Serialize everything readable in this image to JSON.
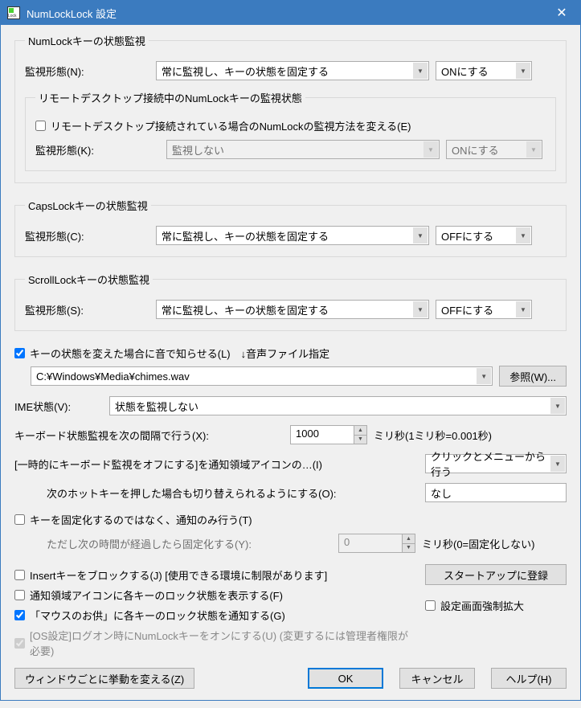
{
  "title": "NumLockLock 設定",
  "groups": {
    "numlock": {
      "legend": "NumLockキーの状態監視",
      "mode_label": "監視形態(N):",
      "mode_value": "常に監視し、キーの状態を固定する",
      "onoff": "ONにする",
      "remote": {
        "legend": "リモートデスクトップ接続中のNumLockキーの監視状態",
        "checkbox_label": "リモートデスクトップ接続されている場合のNumLockの監視方法を変える(E)",
        "mode_label": "監視形態(K):",
        "mode_value": "監視しない",
        "onoff": "ONにする"
      }
    },
    "capslock": {
      "legend": "CapsLockキーの状態監視",
      "mode_label": "監視形態(C):",
      "mode_value": "常に監視し、キーの状態を固定する",
      "onoff": "OFFにする"
    },
    "scrolllock": {
      "legend": "ScrollLockキーの状態監視",
      "mode_label": "監視形態(S):",
      "mode_value": "常に監視し、キーの状態を固定する",
      "onoff": "OFFにする"
    }
  },
  "sound": {
    "checkbox_label": "キーの状態を変えた場合に音で知らせる(L)　↓音声ファイル指定",
    "path": "C:¥Windows¥Media¥chimes.wav",
    "browse": "参照(W)..."
  },
  "ime": {
    "label": "IME状態(V):",
    "value": "状態を監視しない"
  },
  "interval": {
    "label": "キーボード状態監視を次の間隔で行う(X):",
    "value": "1000",
    "suffix": "ミリ秒(1ミリ秒=0.001秒)"
  },
  "tempoff": {
    "label": "[一時的にキーボード監視をオフにする]を通知領域アイコンの…(I)",
    "value": "クリックとメニューから行う"
  },
  "hotkey": {
    "label": "次のホットキーを押した場合も切り替えられるようにする(O):",
    "value": "なし"
  },
  "notifyonly": {
    "checkbox_label": "キーを固定化するのではなく、通知のみ行う(T)",
    "sub_label": "ただし次の時間が経過したら固定化する(Y):",
    "sub_value": "0",
    "sub_suffix": "ミリ秒(0=固定化しない)"
  },
  "checks": {
    "insert": "Insertキーをブロックする(J) [使用できる環境に制限があります]",
    "trayicon": "通知領域アイコンに各キーのロック状態を表示する(F)",
    "mouse": "「マウスのお供」に各キーのロック状態を通知する(G)",
    "oslogon": "[OS設定]ログオン時にNumLockキーをオンにする(U) (変更するには管理者権限が必要)"
  },
  "right_buttons": {
    "startup": "スタートアップに登録",
    "force_enlarge": "設定画面強制拡大"
  },
  "bottom": {
    "per_window": "ウィンドウごとに挙動を変える(Z)",
    "ok": "OK",
    "cancel": "キャンセル",
    "help": "ヘルプ(H)"
  }
}
